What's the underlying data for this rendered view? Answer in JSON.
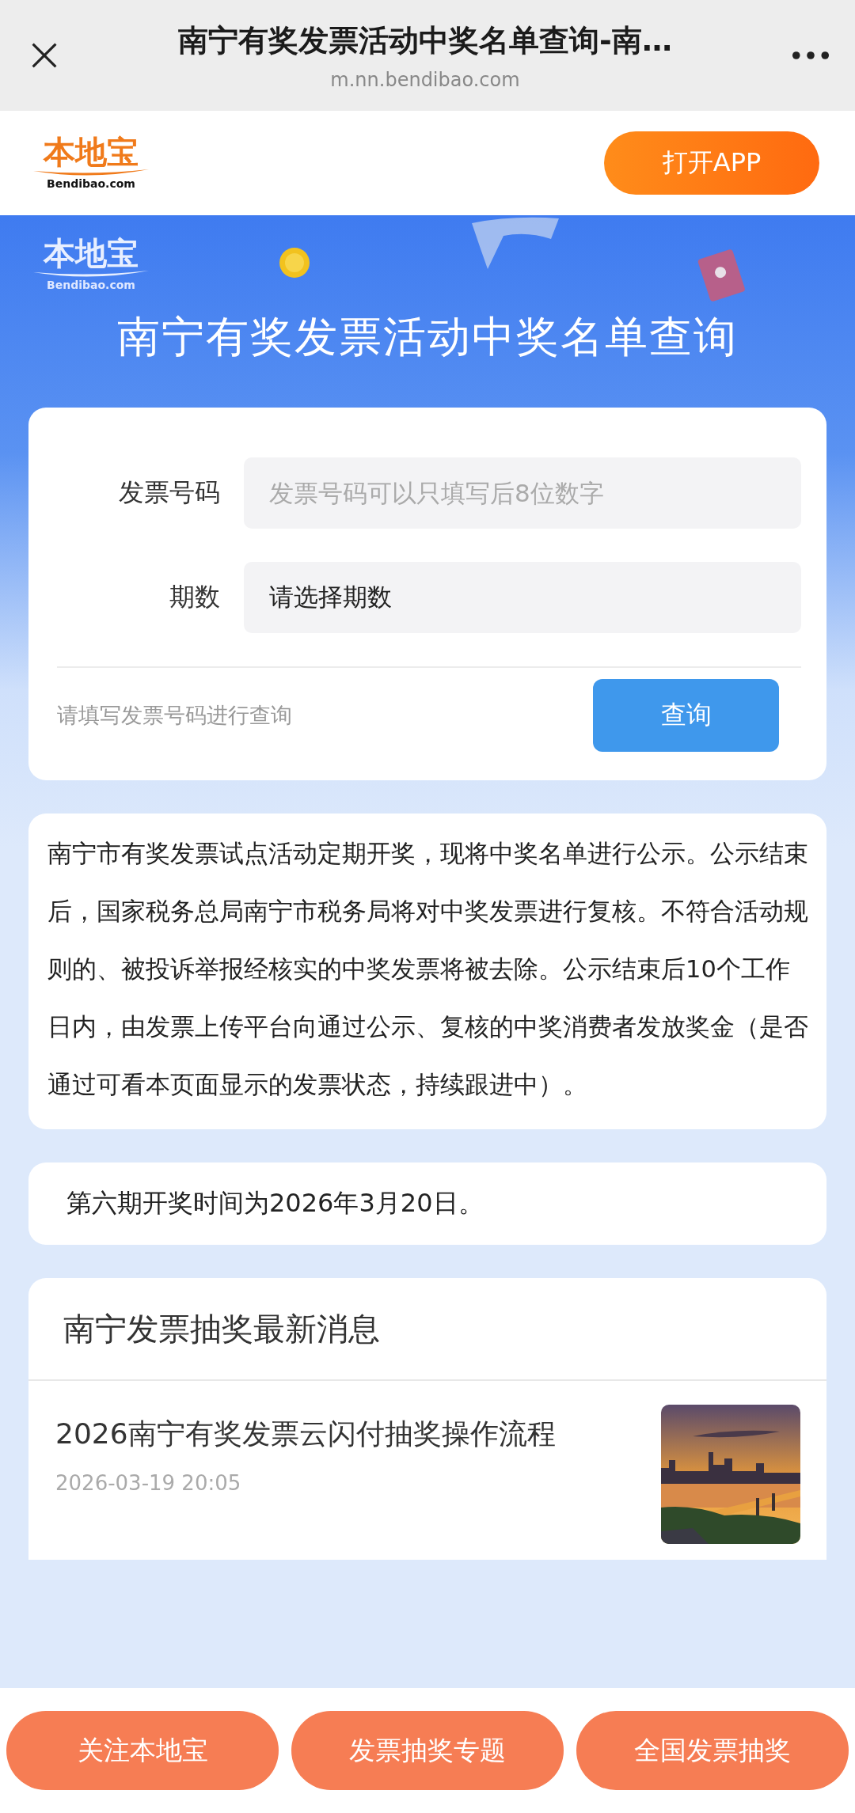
{
  "top_bar": {
    "title": "南宁有奖发票活动中奖名单查询-南…",
    "url": "m.nn.bendibao.com"
  },
  "header": {
    "logo": {
      "name": "本地宝",
      "domain": "Bendibao.com"
    },
    "open_app_button": "打开APP"
  },
  "banner": {
    "logo": {
      "name": "本地宝",
      "domain": "Bendibao.com"
    },
    "title": "南宁有奖发票活动中奖名单查询"
  },
  "form": {
    "fields": [
      {
        "label": "发票号码",
        "placeholder": "发票号码可以只填写后8位数字"
      },
      {
        "label": "期数",
        "value": "请选择期数"
      }
    ],
    "hint": "请填写发票号码进行查询",
    "submit_button": "查询"
  },
  "notice": "南宁市有奖发票试点活动定期开奖，现将中奖名单进行公示。公示结束后，国家税务总局南宁市税务局将对中奖发票进行复核。不符合活动规则的、被投诉举报经核实的中奖发票将被去除。公示结束后10个工作日内，由发票上传平台向通过公示、复核的中奖消费者发放奖金（是否通过可看本页面显示的发票状态，持续跟进中）。",
  "draw_date": "第六期开奖时间为2026年3月20日。",
  "news": {
    "heading": "南宁发票抽奖最新消息",
    "items": [
      {
        "title": "2026南宁有奖发票云闪付抽奖操作流程",
        "date": "2026-03-19 20:05",
        "kind": "picture"
      }
    ]
  },
  "bottom_buttons": [
    "关注本地宝",
    "发票抽奖专题",
    "全国发票抽奖"
  ]
}
